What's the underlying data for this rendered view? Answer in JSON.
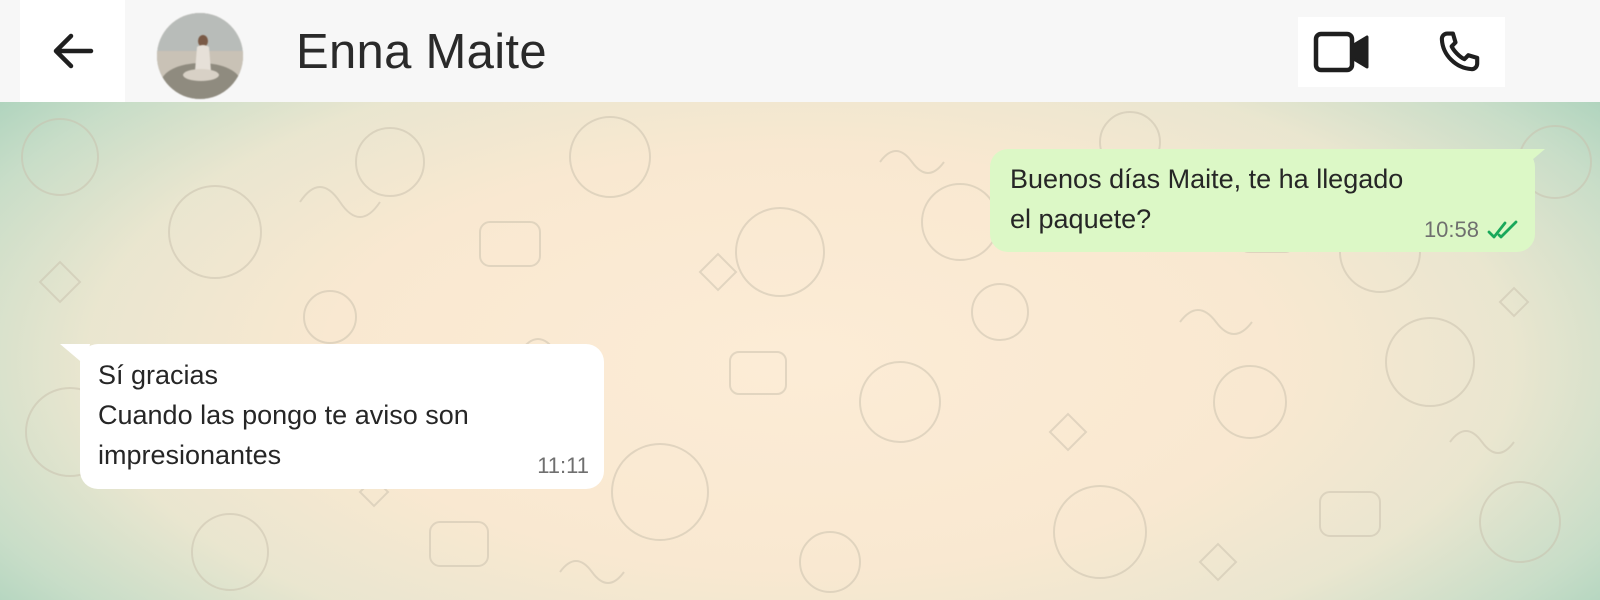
{
  "header": {
    "back_icon": "arrow-left-icon",
    "contact_name": "Enna Maite",
    "video_icon": "video-camera-icon",
    "call_icon": "phone-icon"
  },
  "messages": [
    {
      "direction": "outgoing",
      "lines": [
        "Buenos días Maite, te ha llegado",
        "el paquete?"
      ],
      "time": "10:58",
      "status_icon": "double-check-icon",
      "status_color": "#19a85a"
    },
    {
      "direction": "incoming",
      "lines": [
        "Sí gracias",
        "Cuando las pongo te aviso son",
        "impresionantes"
      ],
      "time": "11:11"
    }
  ],
  "colors": {
    "outgoing_bubble": "#dcf8c6",
    "incoming_bubble": "#ffffff",
    "header_bg": "#f7f7f7",
    "read_ticks": "#19a85a"
  }
}
